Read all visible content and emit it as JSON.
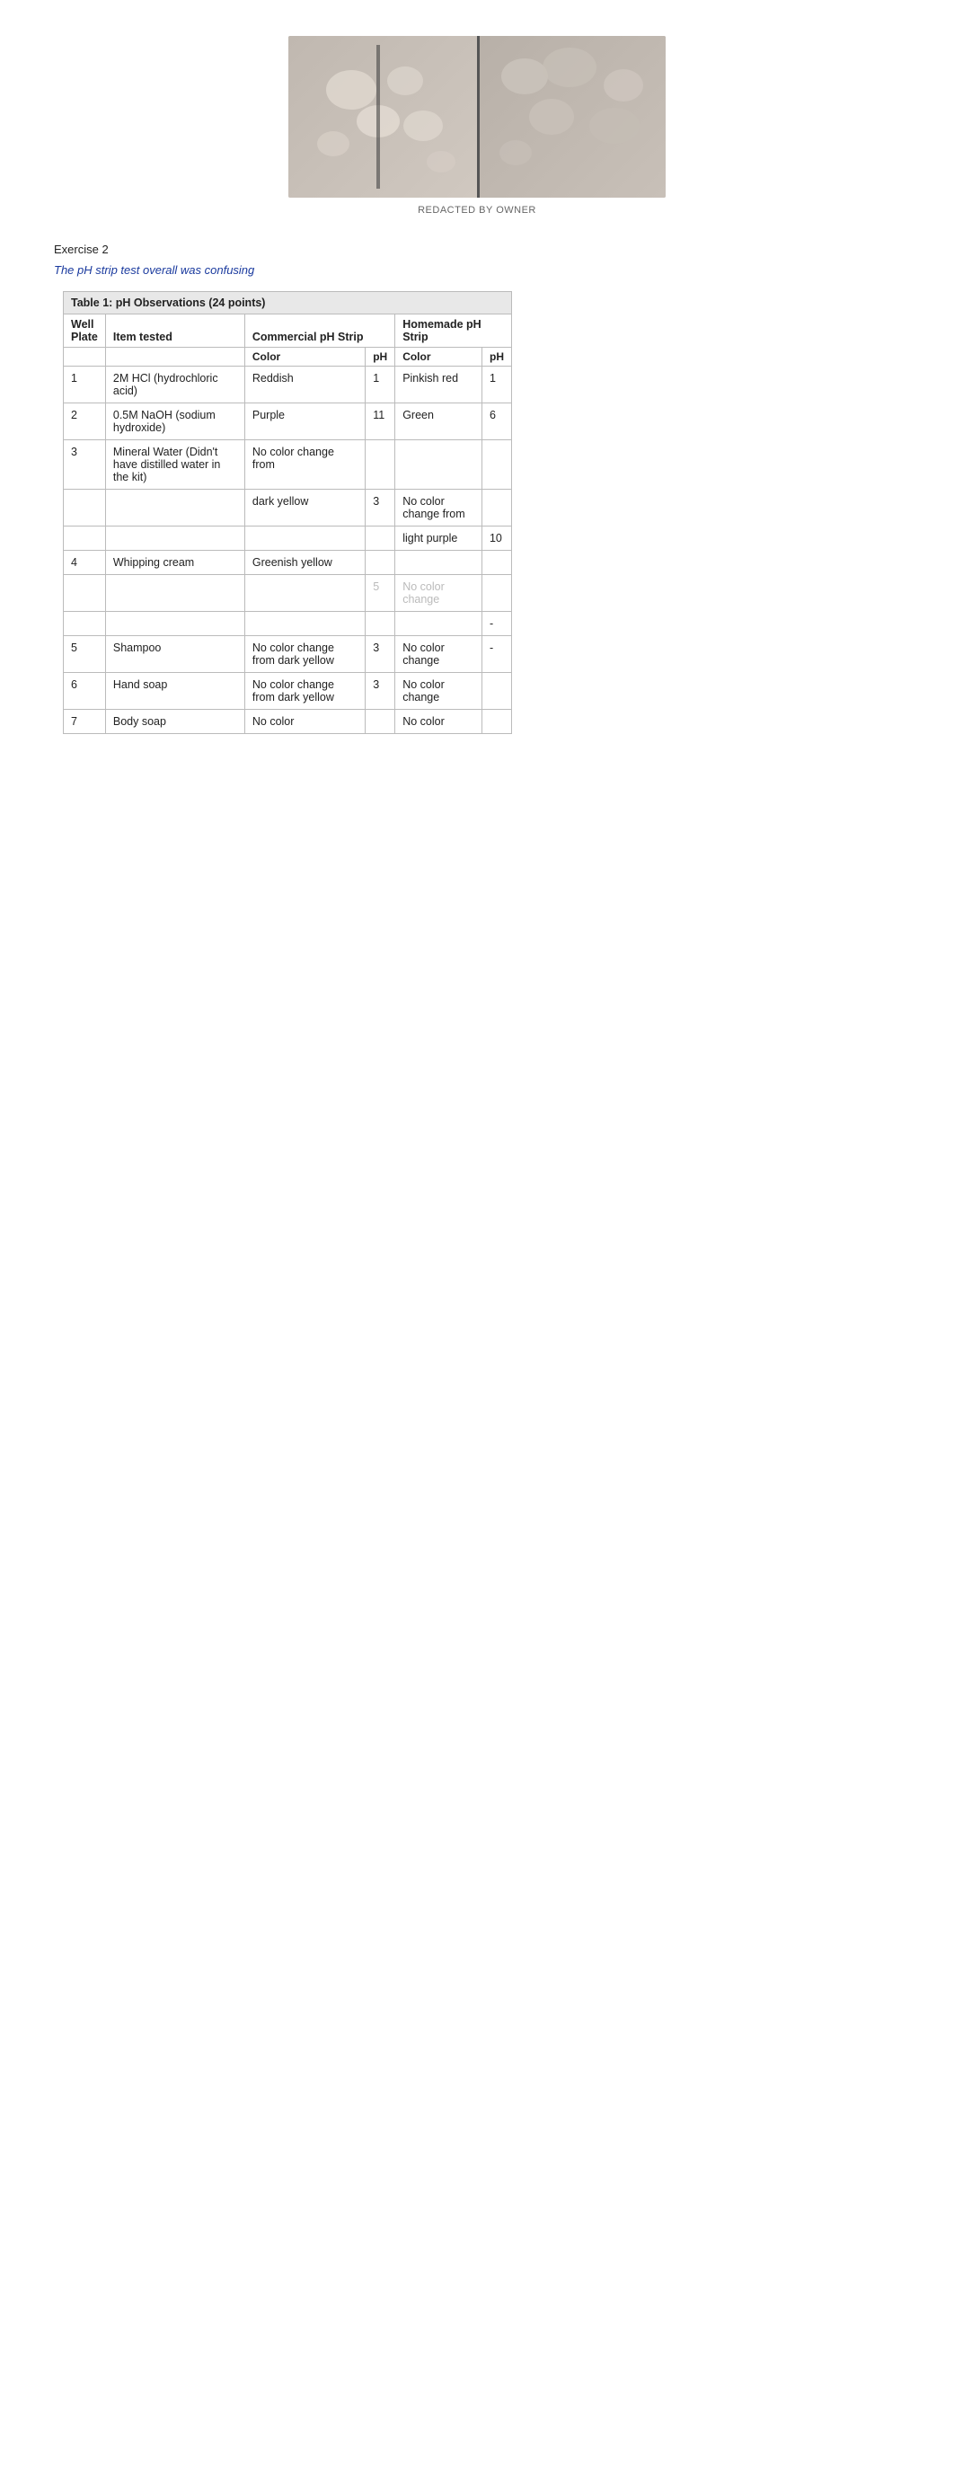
{
  "image": {
    "caption": "REDACTED BY OWNER"
  },
  "exercise": {
    "label": "Exercise 2",
    "subtitle": "The pH strip test overall was confusing"
  },
  "table": {
    "title": "Table 1: pH Observations (24 points)",
    "headers": {
      "well_plate": "Well Plate",
      "item_tested": "Item tested",
      "commercial_ph_strip": "Commercial pH Strip",
      "homemade_ph_strip": "Homemade pH Strip"
    },
    "sub_headers": {
      "color": "Color",
      "ph": "pH"
    },
    "rows": [
      {
        "well": "1",
        "item": "2M HCl (hydrochloric acid)",
        "com_color": "Reddish",
        "com_ph": "1",
        "home_color": "Pinkish red",
        "home_ph": "1",
        "faded": false
      },
      {
        "well": "2",
        "item": "0.5M NaOH (sodium hydroxide)",
        "com_color": "Purple",
        "com_ph": "11",
        "home_color": "Green",
        "home_ph": "6",
        "faded": false
      },
      {
        "well": "3",
        "item": "Mineral Water (Didn't have distilled water in the kit)",
        "com_color": "No color change from",
        "com_ph": "",
        "home_color": "",
        "home_ph": "",
        "faded": false
      },
      {
        "well": "",
        "item": "",
        "com_color": "dark yellow",
        "com_ph": "3",
        "home_color": "No color change from",
        "home_ph": "",
        "faded": false
      },
      {
        "well": "",
        "item": "",
        "com_color": "",
        "com_ph": "",
        "home_color": "light purple",
        "home_ph": "10",
        "faded": false
      },
      {
        "well": "4",
        "item": "Whipping cream",
        "com_color": "Greenish yellow",
        "com_ph": "",
        "home_color": "",
        "home_ph": "",
        "faded": false
      },
      {
        "well": "",
        "item": "",
        "com_color": "",
        "com_ph": "5",
        "home_color": "No color change",
        "home_ph": "",
        "faded": true
      },
      {
        "well": "",
        "item": "",
        "com_color": "",
        "com_ph": "",
        "home_color": "",
        "home_ph": "-",
        "faded": false
      },
      {
        "well": "5",
        "item": "Shampoo",
        "com_color": "No color change from dark yellow",
        "com_ph": "3",
        "home_color": "No color change",
        "home_ph": "-",
        "faded": false
      },
      {
        "well": "6",
        "item": "Hand soap",
        "com_color": "No color change from dark yellow",
        "com_ph": "3",
        "home_color": "No color change",
        "home_ph": "",
        "faded": false
      },
      {
        "well": "7",
        "item": "Body soap",
        "com_color": "No color",
        "com_ph": "",
        "home_color": "No color",
        "home_ph": "",
        "faded": false
      }
    ]
  }
}
